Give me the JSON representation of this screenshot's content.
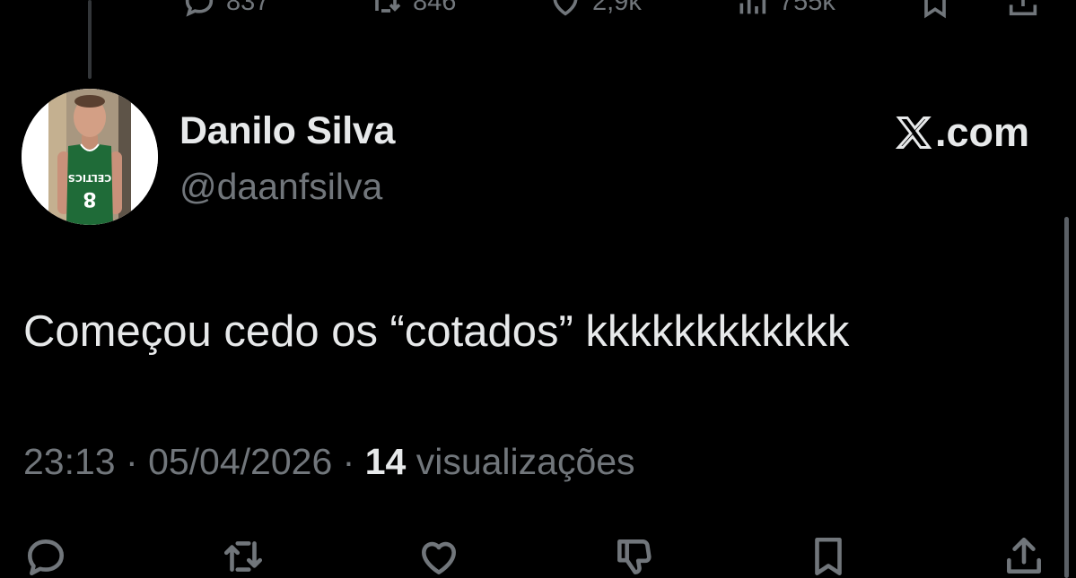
{
  "previous_tweet": {
    "replies": "837",
    "reposts": "846",
    "likes": "2,9k",
    "views": "755k"
  },
  "author": {
    "name": "Danilo Silva",
    "handle": "@daanfsilva",
    "avatar_icon": "avatar-photo",
    "jersey_text": "CELTICS"
  },
  "brand": {
    "domain": ".com",
    "logo_icon": "x-logo-icon"
  },
  "tweet": {
    "text": "Começou cedo os “cotados” kkkkkkkkkkkk",
    "time": "23:13",
    "separator": "·",
    "date": "05/04/2026",
    "views_count": "14",
    "views_label": "visualizações"
  },
  "colors": {
    "background": "#000000",
    "primary_text": "#e7e9ea",
    "secondary_text": "#71767b"
  }
}
